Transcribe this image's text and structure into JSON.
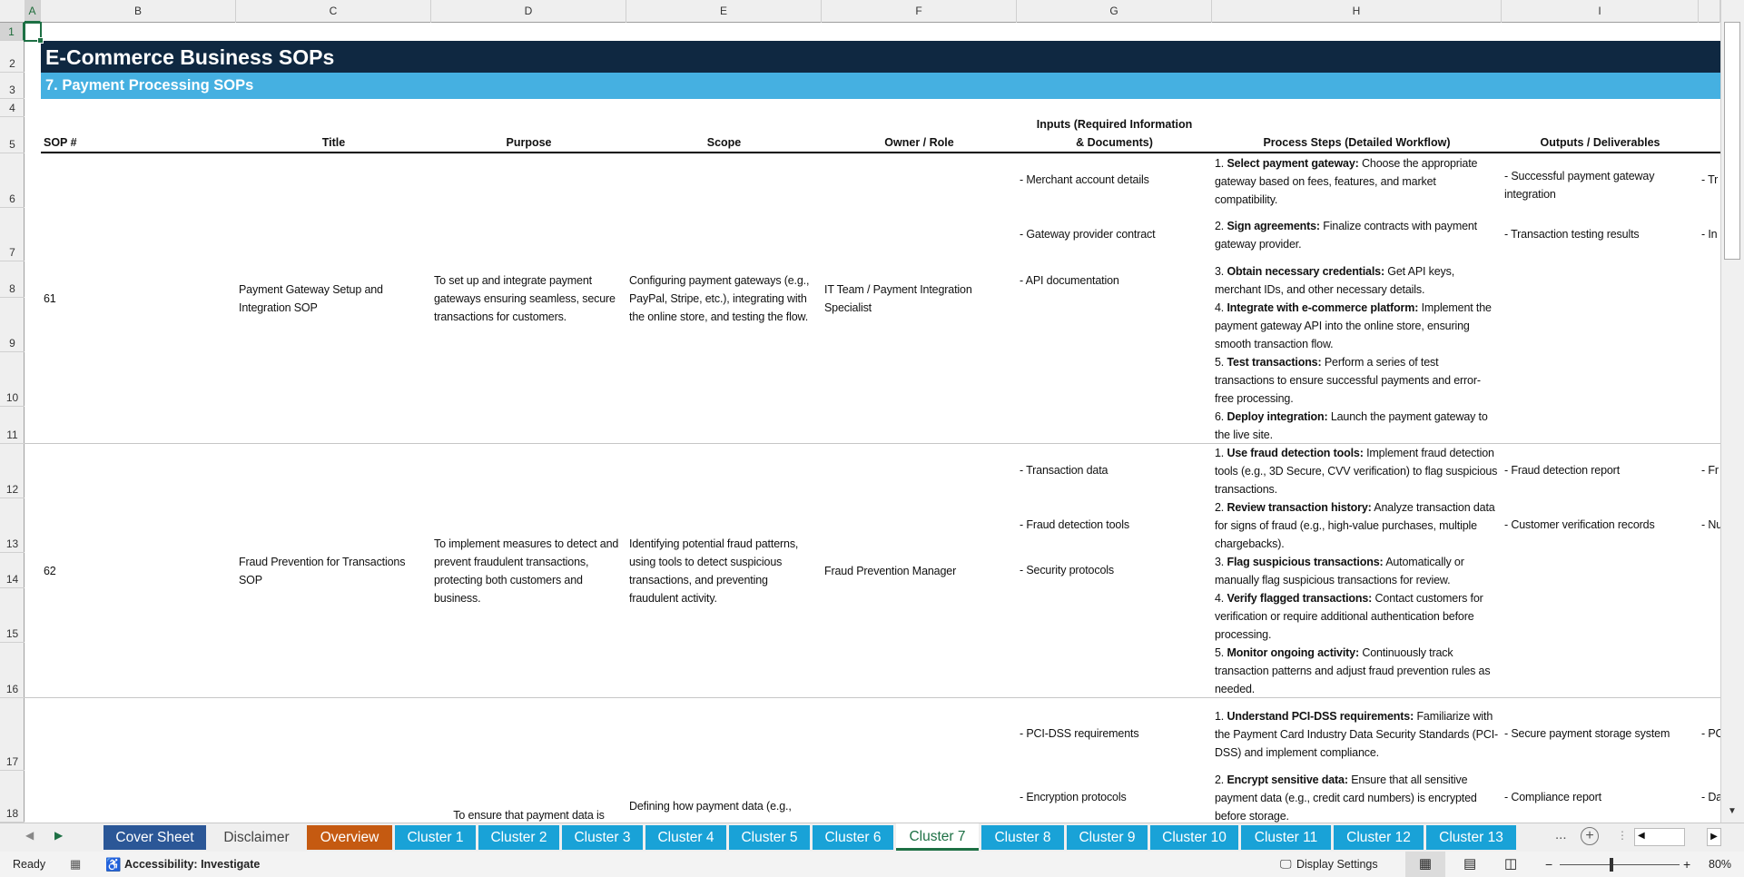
{
  "columns": [
    "A",
    "B",
    "C",
    "D",
    "E",
    "F",
    "G",
    "H",
    "I"
  ],
  "rows": [
    "1",
    "2",
    "3",
    "4",
    "5",
    "6",
    "7",
    "8",
    "9",
    "10",
    "11",
    "12",
    "13",
    "14",
    "15",
    "16",
    "17",
    "18"
  ],
  "title": "E-Commerce Business SOPs",
  "subtitle": "7. Payment Processing SOPs",
  "headers": {
    "sop": "SOP #",
    "title": "Title",
    "purpose": "Purpose",
    "scope": "Scope",
    "owner": "Owner / Role",
    "inputs": "Inputs (Required Information & Documents)",
    "steps": "Process Steps (Detailed Workflow)",
    "outputs": "Outputs / Deliverables"
  },
  "sops": [
    {
      "num": "61",
      "title": "Payment Gateway Setup and Integration SOP",
      "purpose": "To set up and integrate payment gateways ensuring seamless, secure transactions for customers.",
      "scope": "Configuring payment gateways (e.g., PayPal, Stripe, etc.), integrating with the online store, and testing the flow.",
      "owner": "IT Team / Payment Integration Specialist",
      "inputs": [
        "- Merchant account details",
        "- Gateway provider contract",
        "- API documentation"
      ],
      "steps": [
        {
          "n": "1.",
          "bold": "Select payment gateway:",
          "text": "Choose the appropriate gateway based on fees, features, and market compatibility."
        },
        {
          "n": "2.",
          "bold": "Sign agreements:",
          "text": "Finalize contracts with payment gateway provider."
        },
        {
          "n": "3.",
          "bold": "Obtain necessary credentials:",
          "text": "Get API keys, merchant IDs, and other necessary details."
        },
        {
          "n": "4.",
          "bold": "Integrate with e-commerce platform:",
          "text": "Implement the payment gateway API into the online store, ensuring smooth transaction flow."
        },
        {
          "n": "5.",
          "bold": "Test transactions:",
          "text": "Perform a series of test transactions to ensure successful payments and error-free processing."
        },
        {
          "n": "6.",
          "bold": "Deploy integration:",
          "text": "Launch the payment gateway to the live site."
        }
      ],
      "outputs": [
        "- Successful payment gateway integration",
        "- Transaction testing results"
      ],
      "next_col": [
        "- Tr",
        "- In"
      ]
    },
    {
      "num": "62",
      "title": "Fraud Prevention for Transactions SOP",
      "purpose": "To implement measures to detect and prevent fraudulent transactions, protecting both customers and business.",
      "scope": "Identifying potential fraud patterns, using tools to detect suspicious transactions, and preventing fraudulent activity.",
      "owner": "Fraud Prevention Manager",
      "inputs": [
        "- Transaction data",
        "- Fraud detection tools",
        "- Security protocols"
      ],
      "steps": [
        {
          "n": "1.",
          "bold": "Use fraud detection tools:",
          "text": "Implement fraud detection tools (e.g., 3D Secure, CVV verification) to flag suspicious transactions."
        },
        {
          "n": "2.",
          "bold": "Review transaction history:",
          "text": "Analyze transaction data for signs of fraud (e.g., high-value purchases, multiple chargebacks)."
        },
        {
          "n": "3.",
          "bold": "Flag suspicious transactions:",
          "text": "Automatically or manually flag suspicious transactions for review."
        },
        {
          "n": "4.",
          "bold": "Verify flagged transactions:",
          "text": "Contact customers for verification or require additional authentication before processing."
        },
        {
          "n": "5.",
          "bold": "Monitor ongoing activity:",
          "text": "Continuously track transaction patterns and adjust fraud prevention rules as needed."
        }
      ],
      "outputs": [
        "- Fraud detection report",
        "- Customer verification records"
      ],
      "next_col": [
        "- Fr",
        "- Nu"
      ]
    },
    {
      "num": "",
      "title": "",
      "purpose": "To ensure that payment data is",
      "scope": "Defining how payment data (e.g.,",
      "owner": "",
      "inputs": [
        "- PCI-DSS requirements",
        "- Encryption protocols"
      ],
      "steps": [
        {
          "n": "1.",
          "bold": "Understand PCI-DSS requirements:",
          "text": "Familiarize with the Payment Card Industry Data Security Standards (PCI-DSS) and implement compliance."
        },
        {
          "n": "2.",
          "bold": "Encrypt sensitive data:",
          "text": "Ensure that all sensitive payment data (e.g., credit card numbers) is encrypted before storage."
        }
      ],
      "outputs": [
        "- Secure payment storage system",
        "- Compliance report"
      ],
      "next_col": [
        "- PC",
        "- Da"
      ]
    }
  ],
  "tabs": [
    {
      "label": "Cover Sheet",
      "color": "#2b5797"
    },
    {
      "label": "Disclaimer",
      "color": ""
    },
    {
      "label": "Overview",
      "color": "#c55a11"
    },
    {
      "label": "Cluster 1",
      "color": "#19a2d7"
    },
    {
      "label": "Cluster 2",
      "color": "#19a2d7"
    },
    {
      "label": "Cluster 3",
      "color": "#19a2d7"
    },
    {
      "label": "Cluster 4",
      "color": "#19a2d7"
    },
    {
      "label": "Cluster 5",
      "color": "#19a2d7"
    },
    {
      "label": "Cluster 6",
      "color": "#19a2d7"
    },
    {
      "label": "Cluster 7",
      "color": "active"
    },
    {
      "label": "Cluster 8",
      "color": "#19a2d7"
    },
    {
      "label": "Cluster 9",
      "color": "#19a2d7"
    },
    {
      "label": "Cluster 10",
      "color": "#19a2d7"
    },
    {
      "label": "Cluster 11",
      "color": "#19a2d7"
    },
    {
      "label": "Cluster 12",
      "color": "#19a2d7"
    },
    {
      "label": "Cluster 13",
      "color": "#19a2d7"
    }
  ],
  "tabs_more": "...",
  "status": {
    "ready": "Ready",
    "accessibility": "Accessibility: Investigate",
    "display_settings": "Display Settings",
    "zoom": "80%",
    "zoom_level": 0.8
  }
}
